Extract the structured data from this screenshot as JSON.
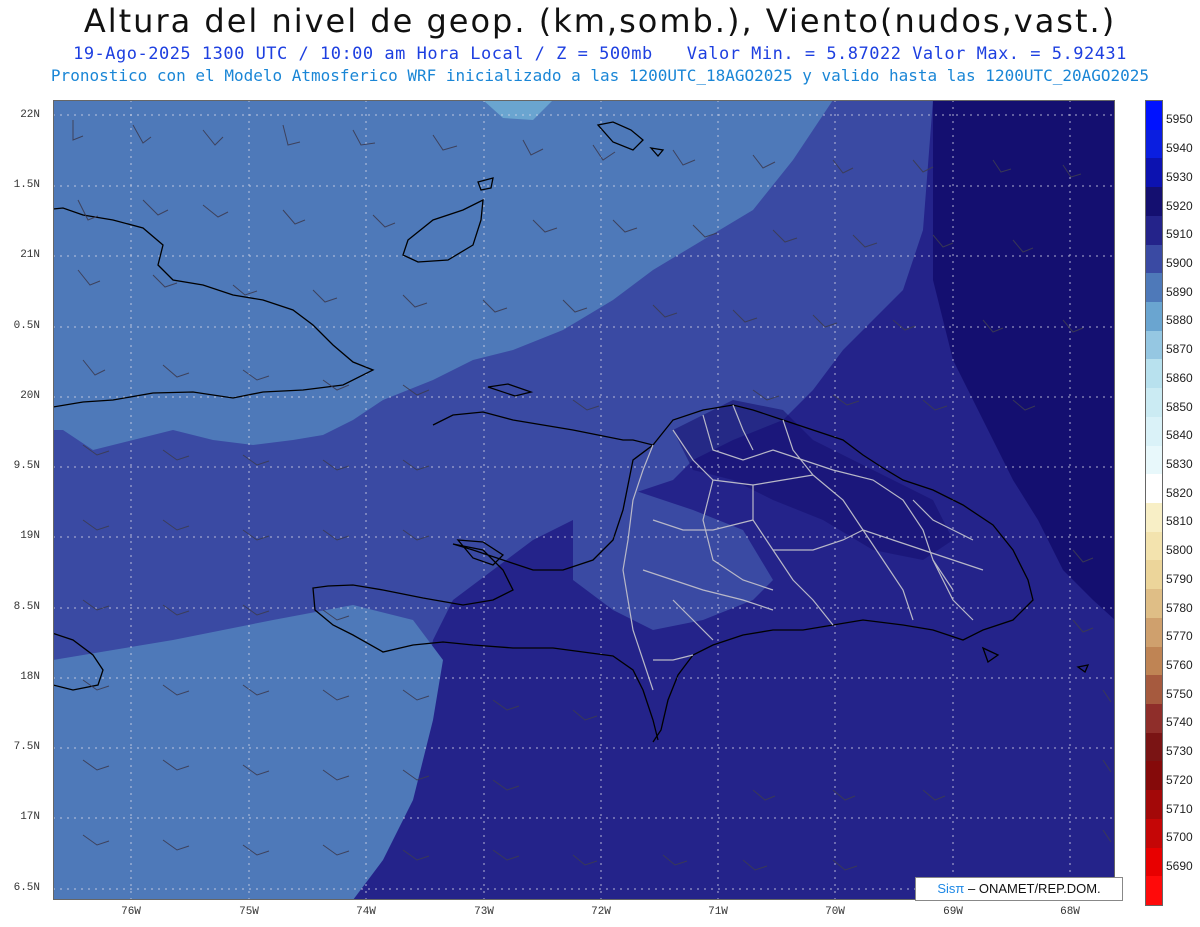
{
  "header": {
    "title": "Altura del nivel de geop. (km,somb.), Viento(nudos,vast.)",
    "line1_left": "19-Ago-2025  1300 UTC / 10:00 am Hora Local / Z = 500mb",
    "line1_right": "Valor Min. = 5.87022  Valor Max. = 5.92431",
    "line2": "Pronostico con el Modelo Atmosferico WRF inicializado a las 1200UTC_18AGO2025 y valido hasta las  1200UTC_20AGO2025"
  },
  "axes": {
    "lat_labels": [
      "22N",
      "1.5N",
      "21N",
      "0.5N",
      "20N",
      "9.5N",
      "19N",
      "8.5N",
      "18N",
      "7.5N",
      "17N",
      "6.5N"
    ],
    "lat_values": [
      22,
      21.5,
      21,
      20.5,
      20,
      19.5,
      19,
      18.5,
      18,
      17.5,
      17,
      16.5
    ],
    "lon_labels": [
      "76W",
      "75W",
      "74W",
      "73W",
      "72W",
      "71W",
      "70W",
      "69W",
      "68W"
    ],
    "lon_values": [
      -76,
      -75,
      -74,
      -73,
      -72,
      -71,
      -70,
      -69,
      -68
    ]
  },
  "colorbar": {
    "labels": [
      "5950",
      "5940",
      "5930",
      "5920",
      "5910",
      "5900",
      "5890",
      "5880",
      "5870",
      "5860",
      "5850",
      "5840",
      "5830",
      "5820",
      "5810",
      "5800",
      "5790",
      "5780",
      "5770",
      "5760",
      "5750",
      "5740",
      "5730",
      "5720",
      "5710",
      "5700",
      "5690"
    ],
    "colors": [
      "#0012ff",
      "#0a1ee0",
      "#0c12b0",
      "#140f70",
      "#24238a",
      "#3a4aa3",
      "#4e79b9",
      "#6aa5d0",
      "#95c7e2",
      "#b8e1ee",
      "#cbebf3",
      "#daf2f8",
      "#e8f8fb",
      "#ffffff",
      "#f8efc6",
      "#f3e3ae",
      "#ecd59a",
      "#dfbe86",
      "#cfa06d",
      "#bf8454",
      "#a65a3e",
      "#8f2e2a",
      "#7a1414",
      "#850a0a",
      "#a30808",
      "#c50606",
      "#e80000",
      "#ff0a0a"
    ]
  },
  "legend": {
    "min": 5.87022,
    "max": 5.92431
  },
  "credit": {
    "brand": "Sisπ",
    "text": "– ONAMET/REP.DOM."
  },
  "colors": {
    "title": "#111111",
    "subtitle1": "#1d3fe0",
    "subtitle2": "#1a86d6",
    "field_5880": "#6aa5d0",
    "field_5890": "#4e79b9",
    "field_5900": "#3a4aa3",
    "field_5910": "#24238a",
    "field_5920": "#140f70"
  }
}
